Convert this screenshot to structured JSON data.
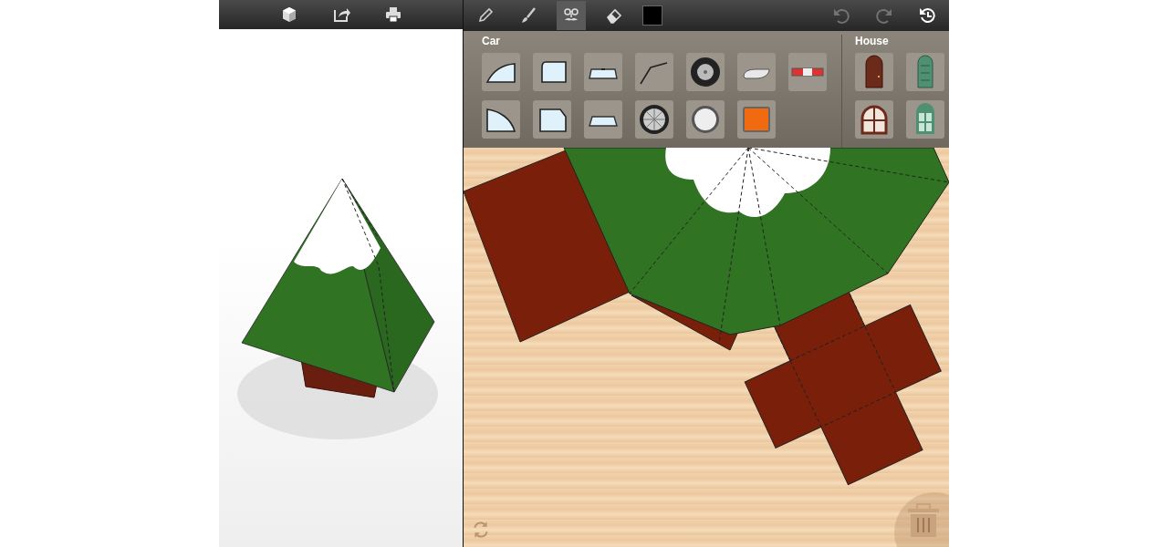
{
  "preview_toolbar": {
    "buttons": [
      {
        "kind": "cube"
      },
      {
        "kind": "share"
      },
      {
        "kind": "print"
      }
    ]
  },
  "edit_toolbar": {
    "tools": [
      {
        "kind": "pencil",
        "selected": false
      },
      {
        "kind": "brush",
        "selected": false
      },
      {
        "kind": "stamp",
        "selected": true
      },
      {
        "kind": "eraser",
        "selected": false
      }
    ],
    "color": "#000000",
    "actions": [
      {
        "kind": "undo",
        "disabled": true
      },
      {
        "kind": "redo",
        "disabled": true
      },
      {
        "kind": "history",
        "disabled": false
      }
    ]
  },
  "palette": {
    "groups": [
      {
        "title": "Car",
        "items": [
          {
            "kind": "rear-window"
          },
          {
            "kind": "side-window"
          },
          {
            "kind": "windshield"
          },
          {
            "kind": "wiper"
          },
          {
            "kind": "tire"
          },
          {
            "kind": "headlight"
          },
          {
            "kind": "taillight"
          },
          {
            "kind": "quarter-window"
          },
          {
            "kind": "square-window"
          },
          {
            "kind": "flat-windshield"
          },
          {
            "kind": "spoked-wheel"
          },
          {
            "kind": "round-light"
          },
          {
            "kind": "orange-light"
          }
        ]
      },
      {
        "title": "House",
        "items": [
          {
            "kind": "door"
          },
          {
            "kind": "green-door"
          },
          {
            "kind": "arched-window"
          },
          {
            "kind": "green-window"
          }
        ]
      }
    ]
  }
}
